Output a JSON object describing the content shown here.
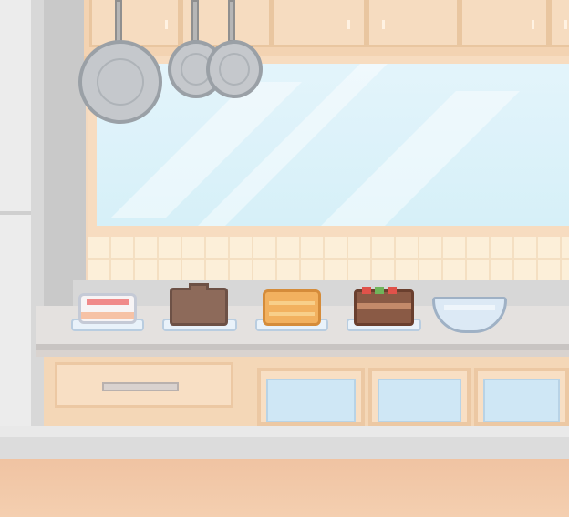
{
  "scene": {
    "location": "kitchen",
    "colors": {
      "cabinet": "#f3d3b2",
      "counter": "#e4e1df",
      "window_glass": "#dff3fa",
      "floor": "#f2c8a8"
    }
  },
  "hanging_pans": [
    {
      "icon": "frying-pan-icon",
      "size": "large"
    },
    {
      "icon": "frying-pan-icon",
      "size": "medium"
    },
    {
      "icon": "frying-pan-icon",
      "size": "medium"
    }
  ],
  "counter_items": [
    {
      "icon": "frosted-cake-icon"
    },
    {
      "icon": "brown-cake-icon"
    },
    {
      "icon": "sponge-cake-icon"
    },
    {
      "icon": "fruit-chocolate-cake-icon"
    },
    {
      "icon": "empty-glass-bowl-icon"
    }
  ]
}
